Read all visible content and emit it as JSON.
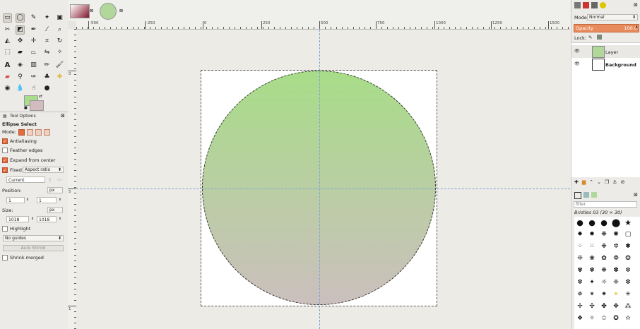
{
  "toolbox": {
    "panel_title": "Tool Options",
    "tool_name": "Ellipse Select",
    "mode_label": "Mode:",
    "antialiasing_label": "Antialiasing",
    "feather_label": "Feather edges",
    "expand_label": "Expand from center",
    "fixed_label": "Fixed:",
    "fixed_value": "Aspect ratio",
    "current_value": "Current",
    "position_label": "Position:",
    "position_unit": "px",
    "position_x": "1",
    "position_y": "1",
    "size_label": "Size:",
    "size_unit": "px",
    "size_w": "1018",
    "size_h": "1018",
    "highlight_label": "Highlight",
    "guides_value": "No guides",
    "autoshrink_label": "Auto Shrink",
    "shrink_merged_label": "Shrink merged",
    "fg_color": "#a9dd8b",
    "bg_color": "#d3bcbf"
  },
  "ruler": {
    "h_labels": [
      "-500",
      "-250",
      "0",
      "250",
      "500",
      "750",
      "1000",
      "1250",
      "1500"
    ],
    "v_labels": [
      "0",
      "5",
      "1"
    ]
  },
  "layers": {
    "mode_label": "Mode",
    "mode_value": "Normal",
    "opacity_label": "Opacity",
    "opacity_value": "100.0",
    "lock_label": "Lock:",
    "items": [
      {
        "name": "Layer"
      },
      {
        "name": "Background"
      }
    ]
  },
  "brushes": {
    "filter_placeholder": "filter",
    "current_brush": "Bristles 03 (30 × 30)"
  },
  "colors": {
    "circle_top": "#a8dd88",
    "circle_bottom": "#cbbfbd",
    "accent": "#e46b3e"
  }
}
